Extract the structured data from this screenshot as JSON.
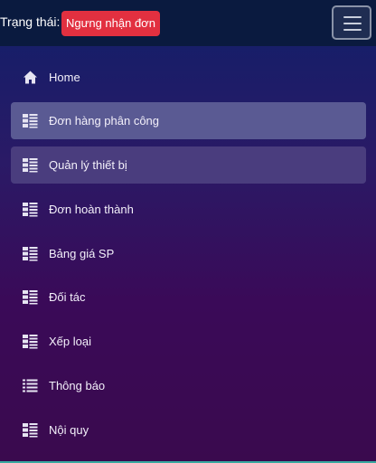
{
  "header": {
    "status_label": "Trạng thái:",
    "status_badge": "Ngưng nhận đơn",
    "menu_toggle_icon": "hamburger-icon"
  },
  "colors": {
    "badge": "#e23040",
    "active_item": "#5a5a93",
    "hover_item": "#4a3d7e",
    "header_bg": "#0a1a3f"
  },
  "sidebar": {
    "items": [
      {
        "label": "Home",
        "icon": "home-icon"
      },
      {
        "label": "Đơn hàng phân công",
        "icon": "list-detail-icon",
        "state": "active"
      },
      {
        "label": "Quản lý thiết bị",
        "icon": "list-detail-icon",
        "state": "highlight"
      },
      {
        "label": "Đơn hoàn thành",
        "icon": "list-detail-icon"
      },
      {
        "label": "Bảng giá SP",
        "icon": "list-detail-icon"
      },
      {
        "label": "Đối tác",
        "icon": "list-detail-icon"
      },
      {
        "label": "Xếp loại",
        "icon": "list-detail-icon"
      },
      {
        "label": "Thông báo",
        "icon": "list-icon"
      },
      {
        "label": "Nội quy",
        "icon": "list-detail-icon"
      }
    ]
  }
}
